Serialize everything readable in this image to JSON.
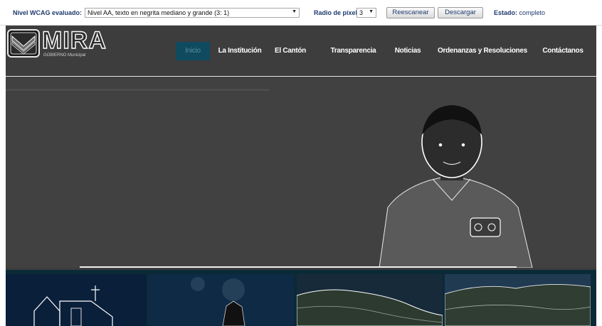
{
  "toolbar": {
    "wcag_label": "Nivel WCAG evaluado:",
    "wcag_value": "Nivel AA, texto en negrita mediano y grande (3: 1)",
    "radius_label": "Radio de píxel:",
    "radius_value": "3",
    "rescan_label": "Reescanear",
    "download_label": "Descargar",
    "status_label": "Estado:",
    "status_value": "completo",
    "dropdown_icon": "chevron-down-icon"
  },
  "site": {
    "logo_text": "MIRA",
    "logo_subtitle": "GOBIERNO Municipal",
    "nav": [
      {
        "label": "Inicio",
        "active": true
      },
      {
        "label": "La Institución",
        "active": false
      },
      {
        "label": "El Cantón",
        "active": false
      },
      {
        "label": "Transparencia",
        "active": false
      },
      {
        "label": "Noticias",
        "active": false
      },
      {
        "label": "Ordenanzas y Resoluciones",
        "active": false
      },
      {
        "label": "Contáctanos",
        "active": false
      }
    ],
    "accent_color": "#0f4a60",
    "gallery_color": "#0b2a38"
  }
}
